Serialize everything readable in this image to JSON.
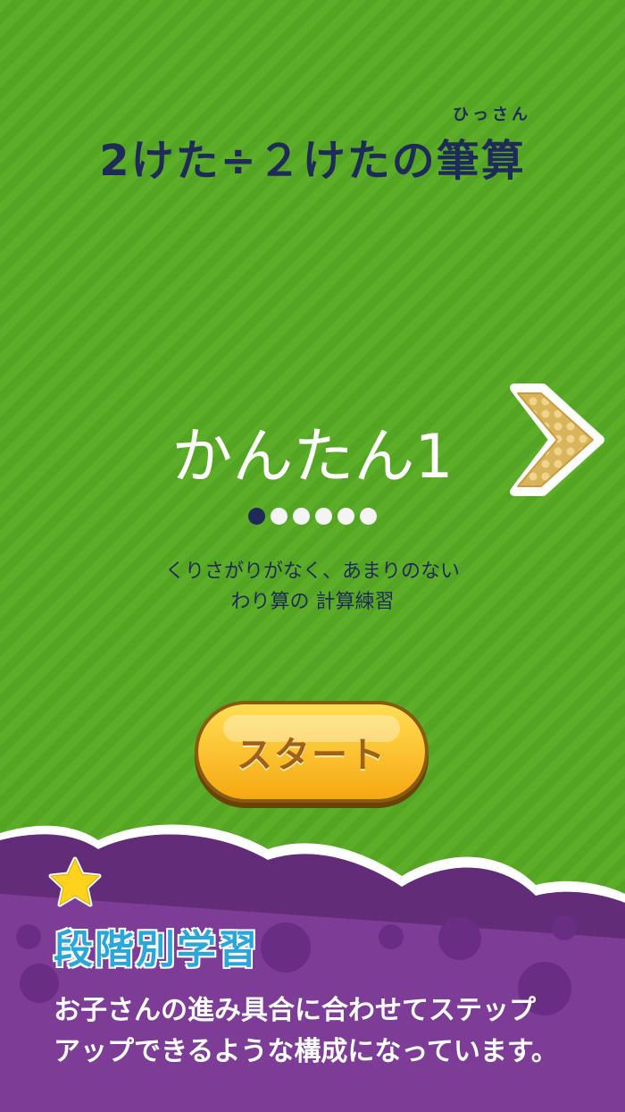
{
  "header": {
    "title": "2けた÷２けたの筆算",
    "ruby": "ひっさん"
  },
  "level": {
    "name": "かんたん1",
    "page_index": 1,
    "page_count": 6,
    "description_line1": "くりさがりがなく、あまりのない",
    "description_line2": "わり算の 計算練習"
  },
  "icons": {
    "next": "chevron-right-icon",
    "star": "star-icon"
  },
  "start_button": {
    "label": "スタート"
  },
  "feature": {
    "title": "段階別学習",
    "line1": "お子さんの進み具合に合わせてステップ",
    "line2": "アップできるような構成になっています。"
  },
  "colors": {
    "background": "#5aaa28",
    "title_text": "#1e2a58",
    "panel": "#7d3d96",
    "button": "#f6c020",
    "feature_title": "#2aa6d8"
  }
}
